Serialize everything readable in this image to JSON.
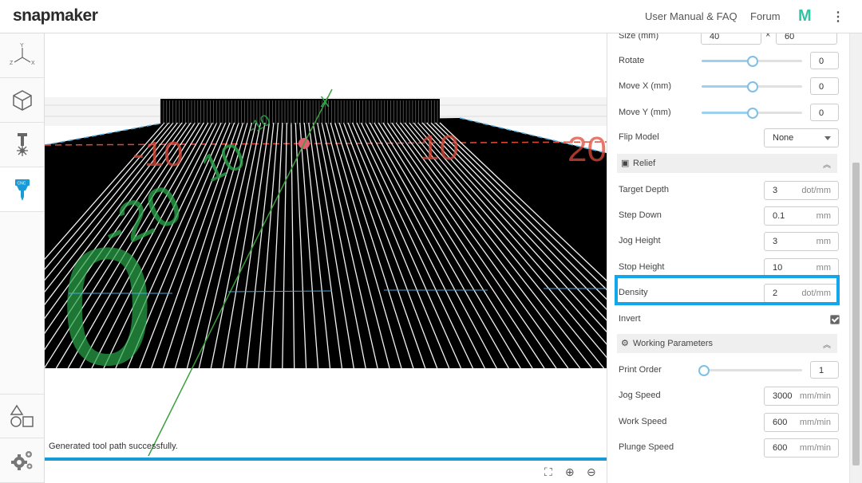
{
  "header": {
    "brand": "snapmaker",
    "user_manual": "User Manual & FAQ",
    "forum": "Forum",
    "m_logo": "M",
    "menu_icon": "⋮"
  },
  "sidebar": {
    "items": [
      {
        "icon": "axes-icon",
        "label_y": "Y",
        "label_z": "Z",
        "label_x": "X"
      },
      {
        "icon": "cube-icon"
      },
      {
        "icon": "laser-icon"
      },
      {
        "icon": "cnc-icon",
        "label": "CNC",
        "active": true
      },
      {
        "icon": "shapes-icon"
      },
      {
        "icon": "settings-icon"
      }
    ]
  },
  "viewport": {
    "status": "Generated tool path successfully.",
    "axis_labels": {
      "big_zero": "0",
      "neg20": "-20",
      "neg10a": "-10",
      "neg10b": "-10",
      "pos10a": "10",
      "pos10b": "10",
      "pos20": "20",
      "x_axis": "X"
    },
    "controls": [
      "fit-icon",
      "zoom-in-icon",
      "zoom-out-icon"
    ],
    "progress_percent": 100
  },
  "panel": {
    "size": {
      "label": "Size (mm)",
      "width": "40",
      "times": "×",
      "height": "60"
    },
    "rotate": {
      "label": "Rotate",
      "value": "0",
      "slider": 0.5
    },
    "move_x": {
      "label": "Move X (mm)",
      "value": "0",
      "slider": 0.5
    },
    "move_y": {
      "label": "Move Y (mm)",
      "value": "0",
      "slider": 0.5
    },
    "flip": {
      "label": "Flip Model",
      "value": "None"
    },
    "relief": {
      "title": "Relief",
      "target_depth": {
        "label": "Target Depth",
        "value": "3",
        "unit": "dot/mm"
      },
      "step_down": {
        "label": "Step Down",
        "value": "0.1",
        "unit": "mm"
      },
      "jog_height": {
        "label": "Jog Height",
        "value": "3",
        "unit": "mm"
      },
      "stop_height": {
        "label": "Stop Height",
        "value": "10",
        "unit": "mm"
      },
      "density": {
        "label": "Density",
        "value": "2",
        "unit": "dot/mm"
      },
      "invert": {
        "label": "Invert",
        "checked": true
      }
    },
    "working": {
      "title": "Working Parameters",
      "print_order": {
        "label": "Print Order",
        "value": "1",
        "slider": 0.0
      },
      "jog_speed": {
        "label": "Jog Speed",
        "value": "3000",
        "unit": "mm/min"
      },
      "work_speed": {
        "label": "Work Speed",
        "value": "600",
        "unit": "mm/min"
      },
      "plunge_speed": {
        "label": "Plunge Speed",
        "value": "600",
        "unit": "mm/min"
      }
    }
  },
  "colors": {
    "accent": "#12a6ea",
    "toolpath": "#000000",
    "grid_green": "#2aa84a",
    "axis_red": "#e04a3a"
  }
}
